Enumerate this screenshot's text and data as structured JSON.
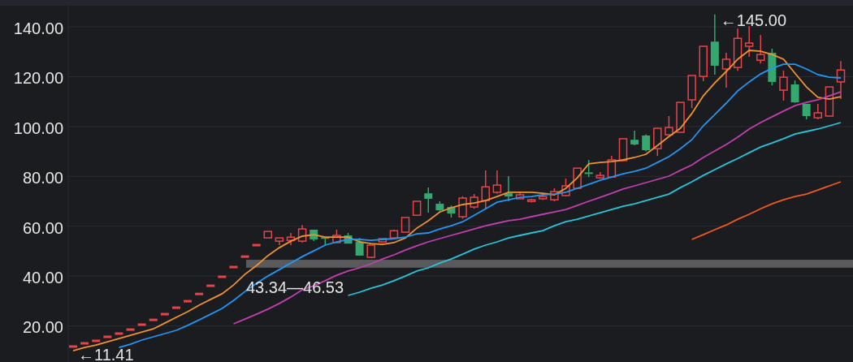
{
  "chart_data": {
    "type": "candlestick",
    "ylim": [
      5.5,
      148.5
    ],
    "grid": true,
    "yticks": [
      {
        "value": 140,
        "label": "140.00"
      },
      {
        "value": 120,
        "label": "120.00"
      },
      {
        "value": 100,
        "label": "100.00"
      },
      {
        "value": 80,
        "label": "80.00"
      },
      {
        "value": 60,
        "label": "60.00"
      },
      {
        "value": 40,
        "label": "40.00"
      },
      {
        "value": 20,
        "label": "20.00"
      }
    ],
    "ohlc": [
      [
        11.7,
        11.7,
        11.7,
        11.7
      ],
      [
        13,
        13,
        13,
        13
      ],
      [
        14,
        14,
        14,
        14
      ],
      [
        15.6,
        15.6,
        15.6,
        15.6
      ],
      [
        16.9,
        16.9,
        16.9,
        16.9
      ],
      [
        18.5,
        18.5,
        18.5,
        18.5
      ],
      [
        20.5,
        20.5,
        20.5,
        20.5
      ],
      [
        22.4,
        22.4,
        22.4,
        22.4
      ],
      [
        24.7,
        24.7,
        24.7,
        24.7
      ],
      [
        27.3,
        27.3,
        27.3,
        27.3
      ],
      [
        29.9,
        29.9,
        29.9,
        29.9
      ],
      [
        32.8,
        32.8,
        32.8,
        32.8
      ],
      [
        36.1,
        36.1,
        36.1,
        36.1
      ],
      [
        39.7,
        39.7,
        39.7,
        39.7
      ],
      [
        43.6,
        43.6,
        43.6,
        43.6
      ],
      [
        47.8,
        47.8,
        47.8,
        47.8
      ],
      [
        52.4,
        52.4,
        52.4,
        52.4
      ],
      [
        55.3,
        57.9,
        55.3,
        57.9
      ],
      [
        54,
        55.3,
        52.4,
        55.3
      ],
      [
        54.3,
        57.3,
        52.4,
        55.6
      ],
      [
        54,
        60.5,
        53.4,
        58.9
      ],
      [
        58.6,
        58.6,
        54,
        54.7
      ],
      [
        55.6,
        55.6,
        52.4,
        55
      ],
      [
        53.4,
        58.6,
        53.4,
        56.3
      ],
      [
        56.3,
        57.3,
        53,
        53
      ],
      [
        53.7,
        55.3,
        48.2,
        48.2
      ],
      [
        47.5,
        52.4,
        47.2,
        52.4
      ],
      [
        53.7,
        55,
        53.7,
        55
      ],
      [
        55.3,
        58.6,
        55.3,
        58.2
      ],
      [
        57.6,
        63.5,
        57.6,
        63.5
      ],
      [
        64.4,
        70,
        64.4,
        70
      ],
      [
        73.2,
        75.5,
        65.4,
        71
      ],
      [
        69,
        70,
        66,
        66.4
      ],
      [
        67.7,
        68.3,
        63.5,
        65.1
      ],
      [
        63.8,
        72,
        63,
        71.3
      ],
      [
        67.7,
        72.9,
        67,
        71.6
      ],
      [
        70.3,
        82.4,
        66.7,
        75.8
      ],
      [
        73.6,
        82.4,
        73,
        76.5
      ],
      [
        73.2,
        80.1,
        70,
        71.9
      ],
      [
        71,
        73.5,
        71,
        72.6
      ],
      [
        70,
        71,
        69.5,
        70.6
      ],
      [
        71,
        72.5,
        70.5,
        71.9
      ],
      [
        70.6,
        75.2,
        70,
        73.9
      ],
      [
        72.3,
        79.1,
        72,
        76.2
      ],
      [
        75.2,
        83.3,
        75,
        83.3
      ],
      [
        81.6,
        86.6,
        79.7,
        81.2
      ],
      [
        79.4,
        81.7,
        79,
        80.4
      ],
      [
        79.7,
        88.2,
        79.7,
        86.6
      ],
      [
        86.3,
        95.1,
        86.3,
        95.1
      ],
      [
        94.7,
        98.3,
        92.5,
        92.8
      ],
      [
        96.4,
        96.8,
        90,
        90.5
      ],
      [
        91.1,
        99.5,
        88.2,
        99.3
      ],
      [
        96.7,
        104.2,
        96.5,
        99.6
      ],
      [
        97.7,
        109.7,
        97.5,
        109.7
      ],
      [
        110.7,
        120.5,
        107.4,
        120.5
      ],
      [
        120.1,
        132.2,
        118.2,
        132.2
      ],
      [
        134.1,
        145,
        120.8,
        124.4
      ],
      [
        123.1,
        129.6,
        115.6,
        127
      ],
      [
        123.7,
        139.3,
        122.4,
        135.4
      ],
      [
        132.2,
        140.3,
        128,
        133.5
      ],
      [
        126.6,
        136.7,
        125.3,
        128.9
      ],
      [
        129.6,
        131.2,
        116.5,
        117.9
      ],
      [
        114.6,
        122.4,
        110.4,
        119.8
      ],
      [
        116.9,
        118.5,
        109.5,
        109.7
      ],
      [
        109.1,
        109.1,
        102.9,
        104.2
      ],
      [
        103.5,
        109.1,
        102.9,
        105.5
      ],
      [
        104.2,
        115.9,
        104,
        115.9
      ],
      [
        117.9,
        126.3,
        111,
        122.7
      ]
    ],
    "series": [
      {
        "type": "line",
        "color": "#f0922e",
        "values": [
          10.0,
          11.3,
          12.3,
          13.6,
          14.9,
          16.2,
          17.5,
          18.8,
          21.1,
          23.4,
          25.7,
          28.3,
          30.6,
          32.9,
          36.4,
          40.7,
          44.2,
          48.2,
          51.4,
          54.0,
          56.0,
          56.6,
          55.6,
          55.6,
          55.6,
          53.7,
          53.0,
          52.7,
          53.4,
          55.3,
          59.2,
          62.2,
          65.7,
          67.4,
          68.7,
          69.3,
          70.3,
          71.9,
          73.6,
          73.6,
          73.6,
          73.2,
          72.6,
          75.2,
          79.4,
          85.0,
          85.6,
          85.9,
          86.6,
          87.6,
          88.9,
          92.4,
          96.0,
          99.3,
          105.2,
          112.3,
          117.5,
          122.1,
          127.0,
          130.6,
          130.2,
          128.9,
          127.0,
          121.4,
          115.9,
          111.7,
          111.0,
          112.0
        ]
      },
      {
        "type": "line",
        "color": "#2196f3",
        "values": [
          null,
          null,
          null,
          null,
          11.3,
          12.6,
          14.3,
          15.6,
          16.9,
          18.2,
          20.2,
          22.4,
          24.7,
          27.0,
          30.2,
          33.8,
          37.1,
          40.0,
          42.6,
          45.2,
          47.8,
          50.1,
          52.4,
          53.7,
          54.7,
          54.7,
          54.3,
          54.7,
          55.0,
          55.6,
          56.9,
          57.3,
          58.9,
          60.2,
          61.8,
          64.4,
          67.0,
          69.6,
          70.6,
          71.6,
          71.9,
          72.6,
          72.9,
          73.6,
          75.2,
          76.8,
          78.4,
          79.7,
          81.0,
          82.0,
          83.3,
          85.6,
          87.9,
          91.1,
          94.7,
          100.3,
          104.8,
          109.4,
          114.3,
          117.9,
          121.1,
          123.4,
          125.0,
          125.0,
          123.1,
          120.8,
          119.8,
          119.5
        ]
      },
      {
        "type": "line",
        "color": "#c23fae",
        "values": [
          null,
          null,
          null,
          null,
          null,
          null,
          null,
          null,
          null,
          null,
          null,
          null,
          null,
          null,
          20.8,
          22.7,
          24.7,
          26.7,
          29.0,
          31.6,
          34.5,
          36.1,
          38.1,
          40.3,
          42.0,
          43.3,
          44.9,
          46.8,
          48.5,
          50.4,
          52.1,
          53.7,
          55.0,
          56.3,
          57.6,
          58.9,
          60.2,
          61.2,
          62.2,
          62.8,
          63.8,
          64.8,
          65.7,
          66.7,
          68.3,
          70.0,
          71.6,
          73.2,
          74.9,
          76.2,
          77.5,
          78.8,
          80.1,
          82.4,
          84.6,
          87.6,
          90.2,
          92.8,
          95.7,
          99.0,
          101.6,
          103.9,
          106.2,
          108.4,
          109.7,
          110.7,
          112.3,
          113.9
        ]
      },
      {
        "type": "line",
        "color": "#25c6d9",
        "values": [
          null,
          null,
          null,
          null,
          null,
          null,
          null,
          null,
          null,
          null,
          null,
          null,
          null,
          null,
          null,
          null,
          null,
          null,
          null,
          null,
          null,
          null,
          null,
          null,
          32.2,
          33.5,
          35.1,
          36.4,
          38.1,
          40.0,
          42.0,
          43.3,
          45.2,
          46.8,
          48.8,
          50.8,
          52.4,
          53.7,
          55.3,
          56.3,
          57.3,
          58.2,
          60.2,
          61.8,
          62.8,
          64.1,
          65.4,
          66.7,
          68.0,
          69.0,
          70.3,
          71.6,
          72.9,
          75.5,
          77.8,
          80.4,
          82.7,
          85.0,
          87.2,
          89.5,
          91.8,
          93.4,
          95.1,
          97.0,
          98.0,
          99.0,
          100.3,
          101.6
        ]
      },
      {
        "type": "line",
        "color": "#f05a1e",
        "values": [
          null,
          null,
          null,
          null,
          null,
          null,
          null,
          null,
          null,
          null,
          null,
          null,
          null,
          null,
          null,
          null,
          null,
          null,
          null,
          null,
          null,
          null,
          null,
          null,
          null,
          null,
          null,
          null,
          null,
          null,
          null,
          null,
          null,
          null,
          null,
          null,
          null,
          null,
          null,
          null,
          null,
          null,
          null,
          null,
          null,
          null,
          null,
          null,
          null,
          null,
          null,
          null,
          null,
          null,
          54.7,
          56.6,
          58.6,
          60.5,
          62.8,
          64.8,
          67.0,
          69.0,
          70.6,
          71.9,
          72.9,
          74.5,
          76.2,
          77.8
        ]
      }
    ],
    "bands": [
      {
        "axis": "y",
        "from": 43.34,
        "to": 46.53,
        "color": "#5a5a5c"
      }
    ],
    "annotations": [
      "←145.00",
      "←11.41",
      "43.34—46.53"
    ]
  }
}
